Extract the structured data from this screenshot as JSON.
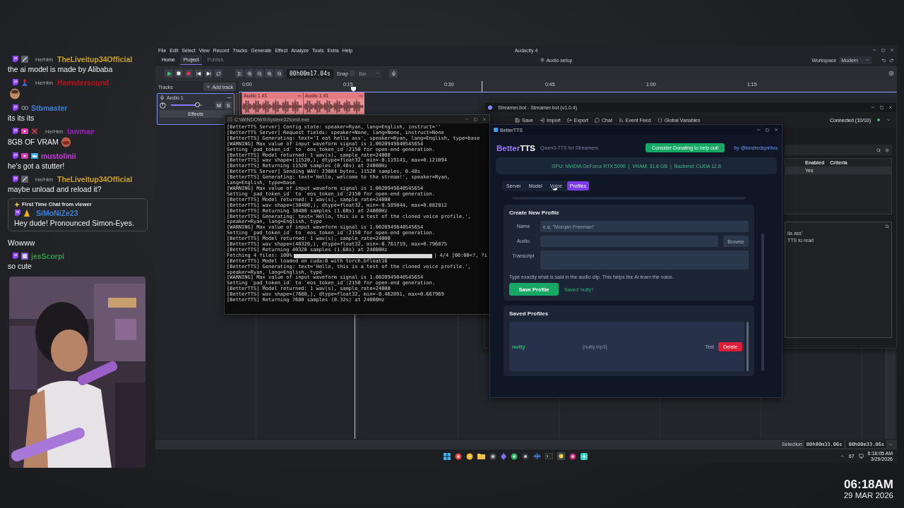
{
  "chat": {
    "messages": [
      {
        "kind": "message",
        "badges": [
          {
            "kind": "pickaxe"
          }
        ],
        "pronouns": "He/Him",
        "username": "TheLiveitup34Official",
        "color": "#c9a227",
        "text": "the ai model is made by Alibaba"
      },
      {
        "kind": "emote_only",
        "badges": [
          {
            "kind": "figure"
          }
        ],
        "pronouns": "He/Him",
        "username": "Hamstersound",
        "color": "#b8141b"
      },
      {
        "kind": "message",
        "badges": [
          {
            "kind": "glasses"
          }
        ],
        "username": "Stbmaster",
        "color": "#3b82d6",
        "text": "its its its"
      },
      {
        "kind": "message_emote",
        "badges": [
          {
            "kind": "gem"
          },
          {
            "kind": "cross"
          }
        ],
        "pronouns": "He/Him",
        "username": "tawmae",
        "color": "#9b1fc0",
        "text": "8GB OF VRAM"
      },
      {
        "kind": "message",
        "badges": [
          {
            "kind": "gem"
          },
          {
            "kind": "crown"
          }
        ],
        "username": "mustolinii",
        "color": "#c23fd6",
        "text": "he's got a stutter!"
      },
      {
        "kind": "message",
        "badges": [
          {
            "kind": "pickaxe"
          }
        ],
        "pronouns": "He/Him",
        "username": "TheLiveitup34Official",
        "color": "#c9a227",
        "text": "maybe unload and reload it?"
      },
      {
        "kind": "highlight",
        "label": "First Time Chat from viewer",
        "badges": [
          {
            "kind": "cone"
          }
        ],
        "username": "SiMoNiZe23",
        "color": "#3b82d6",
        "text": "Hey dude! Pronounced Simon-Eyes."
      },
      {
        "kind": "plain",
        "text": "Wowww"
      },
      {
        "kind": "message",
        "badges": [
          {
            "kind": "tile"
          }
        ],
        "username": "jesScorpi",
        "color": "#2e9a4a",
        "text": "so cute"
      }
    ]
  },
  "audacity": {
    "title": "Audacity 4",
    "menu": [
      "File",
      "Edit",
      "Select",
      "View",
      "Record",
      "Tracks",
      "Generate",
      "Effect",
      "Analyze",
      "Tools",
      "Extra",
      "Help"
    ],
    "tabs": [
      {
        "label": "Home",
        "selected": false,
        "disabled": false
      },
      {
        "label": "Project",
        "selected": true,
        "disabled": false
      },
      {
        "label": "Publish",
        "selected": false,
        "disabled": true
      }
    ],
    "audio_setup": "Audio setup",
    "workspace_label": "Workspace",
    "workspace": "Modern",
    "time": "00h00m17.04s",
    "snap": {
      "label": "Snap",
      "checked": false
    },
    "snap_value": "Bar",
    "tracks_label": "Tracks",
    "add_track": "Add track",
    "ruler": [
      "0:00",
      "0:15",
      "0:30",
      "0:45",
      "1:00",
      "1:15"
    ],
    "track": {
      "name": "Audio 1",
      "mute": "M",
      "solo": "S",
      "effects": "Effects",
      "level": 0.85
    },
    "clips": [
      "Audio 1 #1",
      "Audio 1 #1"
    ],
    "selection_label": "Selection",
    "selection_start": "00h00m33.06s",
    "selection_end": "00h00m33.06s"
  },
  "terminal": {
    "title": "C:\\WINDOWS\\System32\\cmd.exe",
    "lines": [
      {
        "kind": "text",
        "text": "[BetterTTS Server] Config state: speaker=Ryan, lang=English, instruct=''"
      },
      {
        "kind": "text",
        "text": "[BetterTTS Server] Request fields: speaker=None, lang=None, instruct=None"
      },
      {
        "kind": "text",
        "text": "[BetterTTS] Generating: text='I eat hella ass', speaker=Ryan, lang=English, type=base"
      },
      {
        "kind": "text",
        "text": "[WARNING] Max value of input waveform signal is 1.0020949840545654"
      },
      {
        "kind": "text",
        "text": "Setting `pad_token_id` to `eos_token_id`:2150 for open-end generation."
      },
      {
        "kind": "text",
        "text": "[BetterTTS] Model returned: 1 wav(s), sample_rate=24000"
      },
      {
        "kind": "text",
        "text": "[BetterTTS] wav shape=(11520,), dtype=float32, min=-0.119141, max=0.121094"
      },
      {
        "kind": "text",
        "text": "[BetterTTS] Returning 11520 samples (0.48s) at 24000Hz"
      },
      {
        "kind": "text",
        "text": "[BetterTTS Server] Sending WAV: 23084 bytes, 11520 samples, 0.48s"
      },
      {
        "kind": "text",
        "text": "[BetterTTS] Generating: text='Hello, welcome to the stream!', speaker=Ryan, lang=English, type=base"
      },
      {
        "kind": "text",
        "text": "[WARNING] Max value of input waveform signal is 1.0020949840545654"
      },
      {
        "kind": "text",
        "text": "Setting `pad_token_id` to `eos_token_id`:2150 for open-end generation."
      },
      {
        "kind": "text",
        "text": "[BetterTTS] Model returned: 1 wav(s), sample_rate=24000"
      },
      {
        "kind": "text",
        "text": "[BetterTTS] wav shape=(38400,), dtype=float32, min=-0.589844, max=0.882812"
      },
      {
        "kind": "text",
        "text": "[BetterTTS] Returning 38400 samples (1.60s) at 24000Hz"
      },
      {
        "kind": "text",
        "text": "[BetterTTS] Generating: text='Hello, this is a test of the cloned voice profile.', speaker=Ryan, lang=English, type"
      },
      {
        "kind": "text",
        "text": "[WARNING] Max value of input waveform signal is 1.0020949840545654"
      },
      {
        "kind": "text",
        "text": "Setting `pad_token_id` to `eos_token_id`:2150 for open-end generation."
      },
      {
        "kind": "text",
        "text": "[BetterTTS] Model returned: 1 wav(s), sample_rate=24000"
      },
      {
        "kind": "text",
        "text": "[BetterTTS] wav shape=(40320,), dtype=float32, min=-0.761719, max=0.796875"
      },
      {
        "kind": "text",
        "text": "[BetterTTS] Returning 40320 samples (1.68s) at 24000Hz"
      },
      {
        "kind": "progress",
        "text": "Fetching 4 files: 100%",
        "level": 1,
        "tail": "| 4/4 [00:00<?, ?i"
      },
      {
        "kind": "text",
        "text": "[BetterTTS] Model loaded on cuda:0 with torch.bfloat16"
      },
      {
        "kind": "text",
        "text": "[BetterTTS] Generating: text='Hello, this is a test of the cloned voice profile.', speaker=Ryan, lang=English, type"
      },
      {
        "kind": "text",
        "text": "[WARNING] Max value of input waveform signal is 1.0020949840545654"
      },
      {
        "kind": "text",
        "text": "Setting `pad_token_id` to `eos_token_id`:2150 for open-end generation."
      },
      {
        "kind": "text",
        "text": "[BetterTTS] Model returned: 1 wav(s), sample_rate=24000"
      },
      {
        "kind": "text",
        "text": "[BetterTTS] wav shape=(7680,), dtype=float32, min=-0.462891, max=0.667969"
      },
      {
        "kind": "text",
        "text": "[BetterTTS] Returning 7680 samples (0.32s) at 24000Hz"
      }
    ]
  },
  "streamerbot": {
    "title": "Streamer.bot - Streamer.bot (v1.0.4)",
    "toolbar": [
      {
        "kind": "save",
        "label": "Save"
      },
      {
        "kind": "import",
        "label": "Import"
      },
      {
        "kind": "export",
        "label": "Export"
      },
      {
        "kind": "chat",
        "label": "Chat"
      },
      {
        "kind": "feed",
        "label": "Event Feed"
      },
      {
        "kind": "variables",
        "label": "Global Variables"
      }
    ],
    "status": "Connected (10/10)",
    "columns": [
      "Enabled",
      "Criteria"
    ],
    "row": [
      "Yes"
    ],
    "side_lines": [
      "lla ass'",
      "TTS to read"
    ]
  },
  "bettertts": {
    "title": "BetterTTS",
    "brand": [
      "Better",
      "TTS"
    ],
    "subtitle": "Qwen3-TTS for Streamers",
    "donate": "Consider Donating to help out!",
    "author": "by @kindredspiritva",
    "gpu_info": "GPU: NVIDIA GeForce RTX 5090  |  VRAM: 31.8 GB  |  Backend: CUDA 12.8",
    "tabs": [
      {
        "label": "Server",
        "selected": false
      },
      {
        "label": "Model",
        "selected": false
      },
      {
        "label": "Voice",
        "selected": false
      },
      {
        "label": "Profiles",
        "selected": true
      }
    ],
    "create": {
      "title": "Create New Profile",
      "name_label": "Name",
      "name_placeholder": "e.g. \"Morgan Freeman\"",
      "audio_label": "Audio",
      "browse": "Browse",
      "transcript_label": "Transcript",
      "hint": "Type exactly what is said in the audio clip. This helps the AI learn the voice.",
      "save": "Save Profile",
      "status": "Saved 'nutty'!"
    },
    "saved": {
      "title": "Saved Profiles",
      "profiles": [
        {
          "name": "nutty",
          "file": "(nutty.mp3)",
          "test": "Test",
          "delete": "Delete"
        }
      ]
    }
  },
  "taskbar": {
    "tray_count": "67",
    "time": "6:18:05 AM",
    "date": "3/29/2026"
  },
  "clock": {
    "time": "06:18AM",
    "date": "29 MAR 2026"
  }
}
